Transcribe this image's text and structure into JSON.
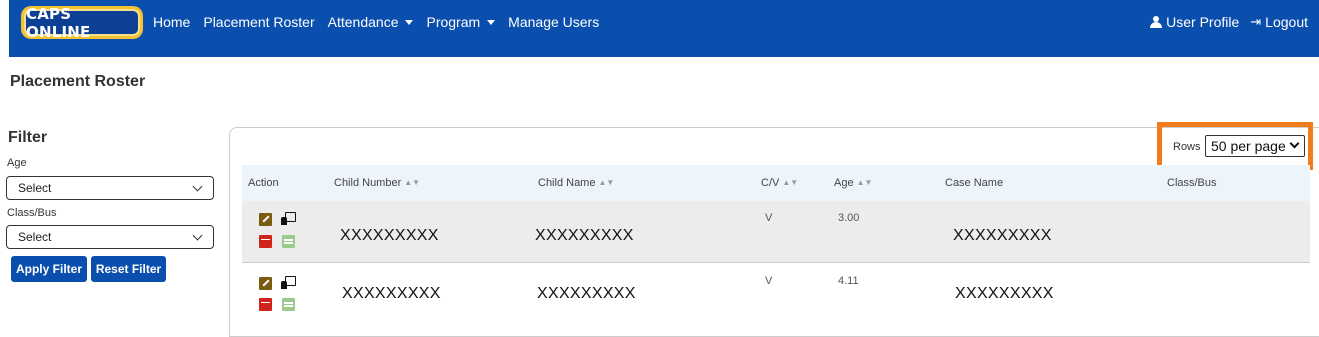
{
  "navbar": {
    "logo_text": "CAPS ONLINE",
    "links": [
      "Home",
      "Placement Roster",
      "Attendance",
      "Program",
      "Manage Users"
    ],
    "user_profile": "User Profile",
    "logout": "Logout"
  },
  "page": {
    "title": "Placement Roster"
  },
  "filter": {
    "title": "Filter",
    "age_label": "Age",
    "age_value": "Select",
    "classbus_label": "Class/Bus",
    "classbus_value": "Select",
    "apply_label": "Apply Filter",
    "reset_label": "Reset Filter"
  },
  "pagination": {
    "rows_label": "Rows",
    "rows_value": "50 per page"
  },
  "table": {
    "headers": [
      "Action",
      "Child Number",
      "Child Name",
      "C/V",
      "Age",
      "Case Name",
      "Class/Bus"
    ],
    "rows": [
      {
        "child_number": "XXXXXXXXX",
        "child_name": "XXXXXXXXX",
        "cv": "V",
        "age": "3.00",
        "case_name": "XXXXXXXXX",
        "class_bus": ""
      },
      {
        "child_number": "XXXXXXXXX",
        "child_name": "XXXXXXXXX",
        "cv": "V",
        "age": "4.11",
        "case_name": "XXXXXXXXX",
        "class_bus": ""
      }
    ]
  },
  "colors": {
    "brand": "#0b4fae",
    "highlight": "#f07c1c",
    "logo_gold": "#f1c232"
  },
  "icons": [
    "user-icon",
    "logout-icon",
    "caret-down-icon",
    "chevron-down-icon",
    "sort-icon",
    "edit-icon",
    "chat-icon",
    "calendar-red-icon",
    "calendar-green-icon"
  ]
}
